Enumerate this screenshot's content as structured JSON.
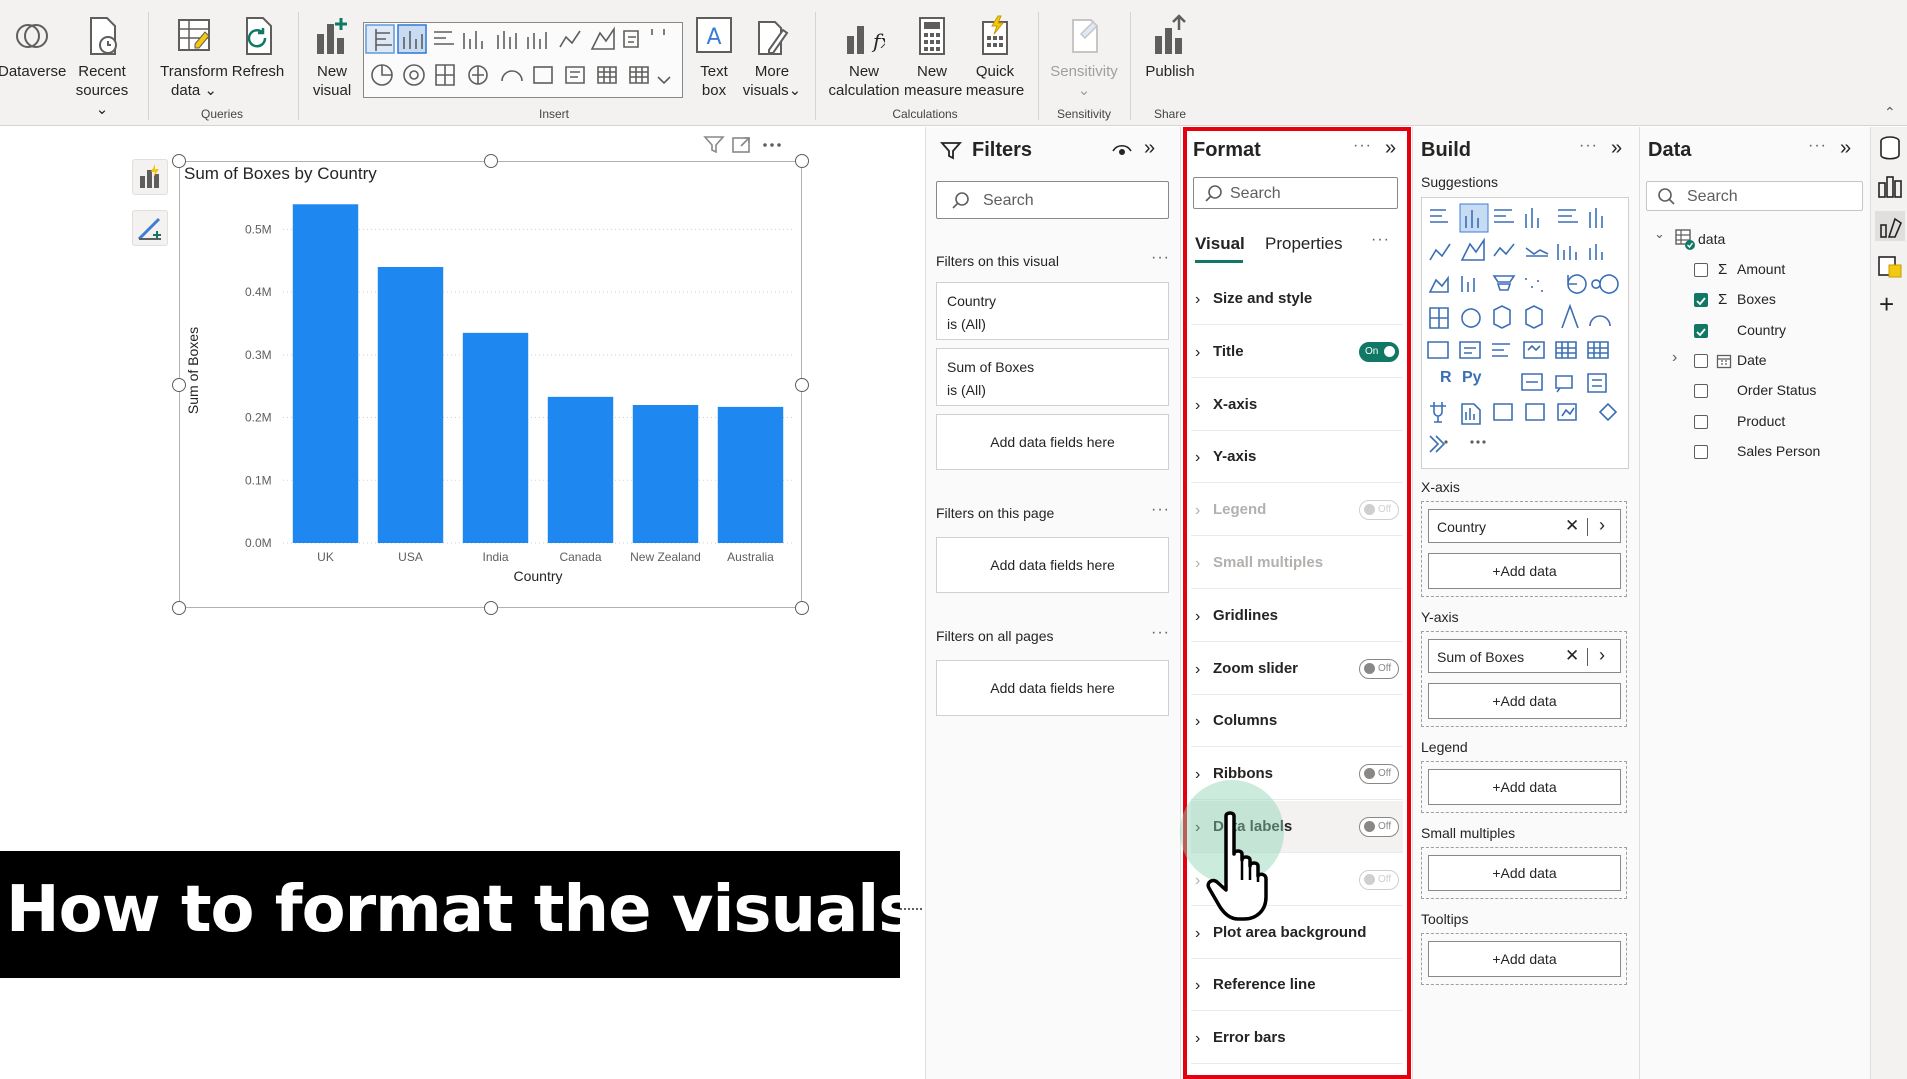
{
  "ribbon": {
    "buttons": {
      "dataverse": "Dataverse",
      "recent_sources_line1": "Recent",
      "recent_sources_line2": "sources",
      "transform_line1": "Transform",
      "transform_line2": "data",
      "refresh": "Refresh",
      "new_visual_line1": "New",
      "new_visual_line2": "visual",
      "text_box_line1": "Text",
      "text_box_line2": "box",
      "more_visuals_line1": "More",
      "more_visuals_line2": "visuals",
      "new_calc_line1": "New",
      "new_calc_line2": "calculation",
      "new_measure_line1": "New",
      "new_measure_line2": "measure",
      "quick_measure_line1": "Quick",
      "quick_measure_line2": "measure",
      "sensitivity": "Sensitivity",
      "publish": "Publish"
    },
    "groups": {
      "queries": "Queries",
      "insert": "Insert",
      "calculations": "Calculations",
      "sensitivity": "Sensitivity",
      "share": "Share"
    }
  },
  "visual": {
    "title": "Sum of Boxes by Country"
  },
  "chart_data": {
    "type": "bar",
    "title": "Sum of Boxes by Country",
    "xlabel": "Country",
    "ylabel": "Sum of Boxes",
    "categories": [
      "UK",
      "USA",
      "India",
      "Canada",
      "New Zealand",
      "Australia"
    ],
    "values": [
      0.54,
      0.44,
      0.335,
      0.233,
      0.22,
      0.217
    ],
    "y_ticks": [
      "0.0M",
      "0.1M",
      "0.2M",
      "0.3M",
      "0.4M",
      "0.5M"
    ],
    "ylim": [
      0,
      0.55
    ],
    "value_unit": "M",
    "bar_color": "#1e88f0",
    "grid": true
  },
  "banner": {
    "text": "How to format the visuals?"
  },
  "filters": {
    "title": "Filters",
    "search_placeholder": "Search",
    "on_visual": "Filters on this visual",
    "cards": [
      {
        "field": "Country",
        "state": "is (All)"
      },
      {
        "field": "Sum of Boxes",
        "state": "is (All)"
      }
    ],
    "add_fields": "Add data fields here",
    "on_page": "Filters on this page",
    "on_all_pages": "Filters on all pages"
  },
  "format": {
    "title": "Format",
    "search_placeholder": "Search",
    "tabs": [
      "Visual",
      "Properties"
    ],
    "sections": [
      {
        "label": "Size and style",
        "toggle": null,
        "dim": false
      },
      {
        "label": "Title",
        "toggle": "On",
        "dim": false
      },
      {
        "label": "X-axis",
        "toggle": null,
        "dim": false
      },
      {
        "label": "Y-axis",
        "toggle": null,
        "dim": false
      },
      {
        "label": "Legend",
        "toggle": "Off",
        "dim": true
      },
      {
        "label": "Small multiples",
        "toggle": null,
        "dim": true
      },
      {
        "label": "Gridlines",
        "toggle": null,
        "dim": false
      },
      {
        "label": "Zoom slider",
        "toggle": "Off",
        "dim": false
      },
      {
        "label": "Columns",
        "toggle": null,
        "dim": false
      },
      {
        "label": "Ribbons",
        "toggle": "Off",
        "dim": false
      },
      {
        "label": "Data labels",
        "toggle": "Off",
        "dim": false
      },
      {
        "label": "",
        "toggle": "Off",
        "dim": true
      },
      {
        "label": "Plot area background",
        "toggle": null,
        "dim": false
      },
      {
        "label": "Reference line",
        "toggle": null,
        "dim": false
      },
      {
        "label": "Error bars",
        "toggle": null,
        "dim": false
      }
    ],
    "highlight_color": "#e5000f"
  },
  "build": {
    "title": "Build",
    "suggestions": "Suggestions",
    "wells": [
      {
        "label": "X-axis",
        "field": "Country",
        "add": "+Add data"
      },
      {
        "label": "Y-axis",
        "field": "Sum of Boxes",
        "add": "+Add data"
      },
      {
        "label": "Legend",
        "field": null,
        "add": "+Add data"
      },
      {
        "label": "Small multiples",
        "field": null,
        "add": "+Add data"
      },
      {
        "label": "Tooltips",
        "field": null,
        "add": "+Add data"
      }
    ]
  },
  "data": {
    "title": "Data",
    "search_placeholder": "Search",
    "table": "data",
    "fields": [
      {
        "name": "Amount",
        "checked": false,
        "sigma": true,
        "expand": false,
        "calendar": false
      },
      {
        "name": "Boxes",
        "checked": true,
        "sigma": true,
        "expand": false,
        "calendar": false
      },
      {
        "name": "Country",
        "checked": true,
        "sigma": false,
        "expand": false,
        "calendar": false
      },
      {
        "name": "Date",
        "checked": false,
        "sigma": false,
        "expand": true,
        "calendar": true
      },
      {
        "name": "Order Status",
        "checked": false,
        "sigma": false,
        "expand": false,
        "calendar": false
      },
      {
        "name": "Product",
        "checked": false,
        "sigma": false,
        "expand": false,
        "calendar": false
      },
      {
        "name": "Sales Person",
        "checked": false,
        "sigma": false,
        "expand": false,
        "calendar": false
      }
    ]
  }
}
